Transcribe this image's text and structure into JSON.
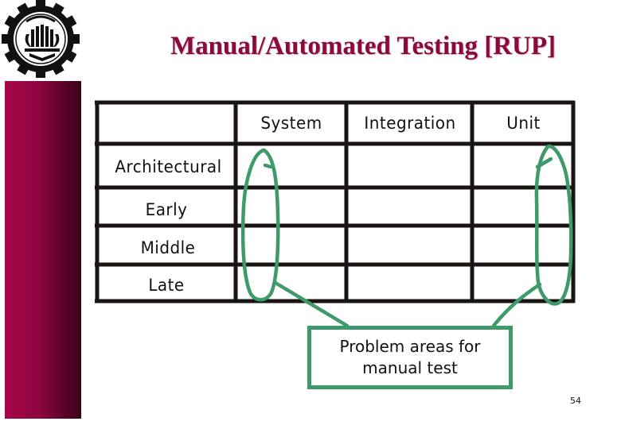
{
  "slide": {
    "title": "Manual/Automated Testing [RUP]",
    "page_number": "54",
    "logo": "university-gear-emblem",
    "accent_color": "#8a0a3c",
    "highlight_color": "#3e9a6a"
  },
  "table": {
    "columns": [
      "",
      "System",
      "Integration",
      "Unit"
    ],
    "rows": [
      {
        "label": "Architectural",
        "cells": [
          "",
          "",
          ""
        ]
      },
      {
        "label": "Early",
        "cells": [
          "",
          "",
          ""
        ]
      },
      {
        "label": "Middle",
        "cells": [
          "",
          "",
          ""
        ]
      },
      {
        "label": "Late",
        "cells": [
          "",
          "",
          ""
        ]
      }
    ],
    "highlighted_columns": [
      "System",
      "Unit"
    ]
  },
  "callout": {
    "line1": "Problem areas for",
    "line2": "manual test"
  }
}
